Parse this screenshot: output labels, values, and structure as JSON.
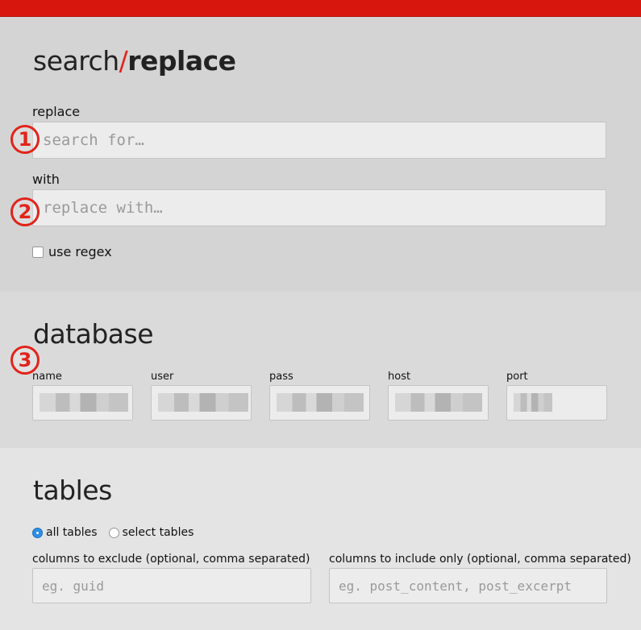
{
  "header": {
    "accent_color": "#d7170e"
  },
  "search_replace": {
    "title_part1": "search",
    "title_slash": "/",
    "title_part2": "replace",
    "replace_label": "replace",
    "replace_placeholder": "search for…",
    "with_label": "with",
    "with_placeholder": "replace with…",
    "regex_label": "use regex",
    "regex_checked": false
  },
  "annotations": {
    "one": "1",
    "two": "2",
    "three": "3"
  },
  "database": {
    "title": "database",
    "fields": [
      {
        "label": "name"
      },
      {
        "label": "user"
      },
      {
        "label": "pass"
      },
      {
        "label": "host"
      },
      {
        "label": "port"
      }
    ]
  },
  "tables": {
    "title": "tables",
    "all_label": "all tables",
    "select_label": "select tables",
    "selected": "all tables",
    "exclude_label": "columns to exclude (optional, comma separated)",
    "exclude_placeholder": "eg. guid",
    "include_label": "columns to include only (optional, comma separated)",
    "include_placeholder": "eg. post_content, post_excerpt"
  }
}
